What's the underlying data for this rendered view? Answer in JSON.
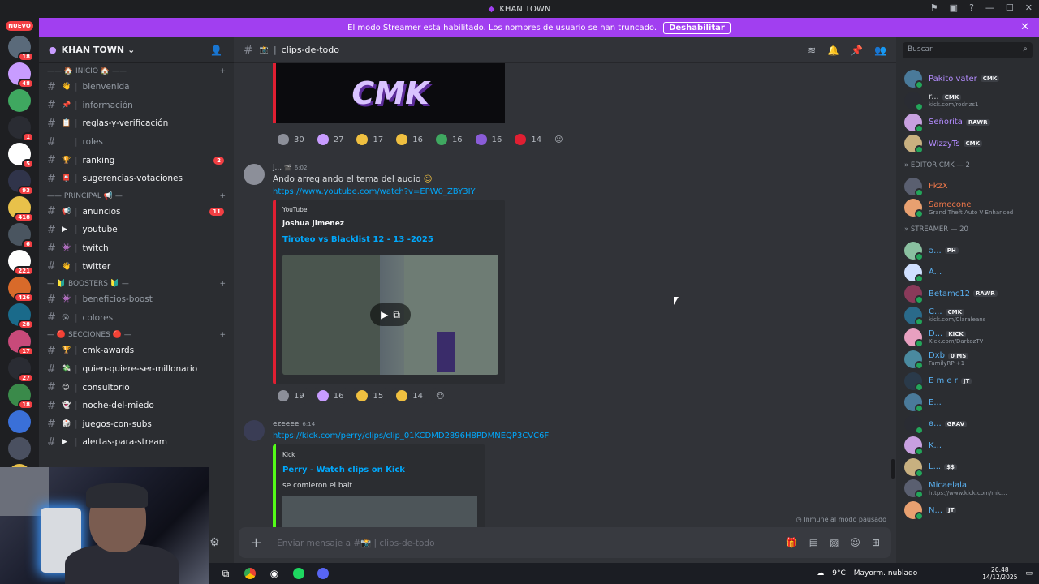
{
  "window": {
    "title": "KHAN TOWN"
  },
  "banner": {
    "message": "El modo Streamer está habilitado. Los nombres de usuario se han truncado.",
    "button": "Deshabilitar"
  },
  "servers": {
    "nuevo": "NUEVO",
    "badges": [
      "18",
      "48",
      "",
      "1",
      "5",
      "93",
      "418",
      "6",
      "221",
      "426",
      "28",
      "17",
      "27",
      "18",
      "",
      "",
      ""
    ]
  },
  "server_name": "KHAN TOWN",
  "categories": {
    "inicio": "INICIO",
    "principal": "PRINCIPAL",
    "boosters": "BOOSTERS",
    "secciones": "SECCIONES"
  },
  "channels_inicio": [
    {
      "name": "bienvenida",
      "emoji": "👋",
      "bold": false,
      "count": ""
    },
    {
      "name": "información",
      "emoji": "📌",
      "bold": false,
      "count": ""
    },
    {
      "name": "reglas-y-verificación",
      "emoji": "📋",
      "bold": true,
      "count": ""
    },
    {
      "name": "roles",
      "emoji": "",
      "bold": false,
      "count": ""
    },
    {
      "name": "ranking",
      "emoji": "🏆",
      "bold": true,
      "count": "2"
    },
    {
      "name": "sugerencias-votaciones",
      "emoji": "📮",
      "bold": true,
      "count": ""
    }
  ],
  "channels_principal": [
    {
      "name": "anuncios",
      "emoji": "📢",
      "bold": true,
      "count": "11"
    },
    {
      "name": "youtube",
      "emoji": "▶",
      "bold": true,
      "count": ""
    },
    {
      "name": "twitch",
      "emoji": "👾",
      "bold": true,
      "count": ""
    },
    {
      "name": "twitter",
      "emoji": "👋",
      "bold": true,
      "count": ""
    }
  ],
  "channels_boosters": [
    {
      "name": "beneficios-boost",
      "emoji": "👾",
      "bold": false,
      "count": ""
    },
    {
      "name": "colores",
      "emoji": "😵",
      "bold": false,
      "count": ""
    }
  ],
  "channels_secciones": [
    {
      "name": "cmk-awards",
      "emoji": "🏆",
      "bold": true,
      "count": ""
    },
    {
      "name": "quien-quiere-ser-millonario",
      "emoji": "💸",
      "bold": true,
      "count": ""
    },
    {
      "name": "consultorio",
      "emoji": "😊",
      "bold": true,
      "count": ""
    },
    {
      "name": "noche-del-miedo",
      "emoji": "👻",
      "bold": true,
      "count": ""
    },
    {
      "name": "juegos-con-subs",
      "emoji": "🎲",
      "bold": true,
      "count": ""
    },
    {
      "name": "alertas-para-stream",
      "emoji": "▶",
      "bold": true,
      "count": ""
    }
  ],
  "header": {
    "channel": "clips-de-todo"
  },
  "messages": {
    "reactions1": [
      "30",
      "27",
      "17",
      "16",
      "16",
      "16",
      "14"
    ],
    "msg2": {
      "author": "j...",
      "time": "6:02",
      "text": "Ando arreglando el tema del audio",
      "link": "https://www.youtube.com/watch?v=EPW0_ZBY3IY",
      "provider": "YouTube",
      "embed_author": "joshua jimenez",
      "embed_title": "Tiroteo vs Blacklist 12 - 13 -2025"
    },
    "reactions2": [
      "19",
      "16",
      "15",
      "14"
    ],
    "msg3": {
      "author": "ezeeee",
      "time": "6:14",
      "link": "https://kick.com/perry/clips/clip_01KCDMD2896H8PDMNEQP3CVC6F",
      "provider": "Kick",
      "embed_title": "Perry - Watch clips on Kick",
      "embed_desc": "se comieron el bait"
    }
  },
  "immune": "Inmune al modo pausado",
  "composer": {
    "placeholder": "Enviar mensaje a #📸 | clips-de-todo"
  },
  "search": {
    "placeholder": "Buscar"
  },
  "members_top": [
    {
      "name": "Pakito vater",
      "tag": "CMK",
      "sub": "",
      "color": "#b48cff"
    },
    {
      "name": "r...",
      "tag": "CMK",
      "sub": "kick.com/rodrizs1",
      "color": "#dbdee1"
    },
    {
      "name": "Señorita",
      "tag": "RAWR",
      "sub": "",
      "color": "#b48cff"
    },
    {
      "name": "WizzyTs",
      "tag": "CMK",
      "sub": "",
      "color": "#b48cff"
    }
  ],
  "cat_editor": "EDITOR CMK — 2",
  "members_editor": [
    {
      "name": "FkzX",
      "tag": "",
      "sub": "",
      "color": "#f0784a"
    },
    {
      "name": "Samecone",
      "tag": "",
      "sub": "Grand Theft Auto V Enhanced",
      "color": "#f0784a"
    }
  ],
  "cat_streamer": "STREAMER — 20",
  "members_streamer": [
    {
      "name": "ə...",
      "tag": "PH",
      "sub": "",
      "color": "#5ab0f0"
    },
    {
      "name": "A...",
      "tag": "",
      "sub": "",
      "color": "#5ab0f0"
    },
    {
      "name": "Betamc12",
      "tag": "RAWR",
      "sub": "",
      "color": "#5ab0f0"
    },
    {
      "name": "C...",
      "tag": "CMK",
      "sub": "kick.com/Claraleans",
      "color": "#5ab0f0"
    },
    {
      "name": "D...",
      "tag": "KICK",
      "sub": "Kick.com/DarkozTV",
      "color": "#5ab0f0"
    },
    {
      "name": "Dxb",
      "tag": "0 MS",
      "sub": "FamilyRP +1",
      "color": "#5ab0f0"
    },
    {
      "name": "E m e r",
      "tag": "JT",
      "sub": "",
      "color": "#5ab0f0"
    },
    {
      "name": "E...",
      "tag": "",
      "sub": "",
      "color": "#5ab0f0"
    },
    {
      "name": "ɵ...",
      "tag": "GRAV",
      "sub": "",
      "color": "#5ab0f0"
    },
    {
      "name": "K...",
      "tag": "",
      "sub": "",
      "color": "#5ab0f0"
    },
    {
      "name": "L...",
      "tag": "$$",
      "sub": "",
      "color": "#5ab0f0"
    },
    {
      "name": "Micaelala",
      "tag": "",
      "sub": "https://www.kick.com/mic...",
      "color": "#5ab0f0"
    },
    {
      "name": "N...",
      "tag": "JT",
      "sub": "",
      "color": "#5ab0f0"
    }
  ],
  "taskbar": {
    "weather_temp": "9°C",
    "weather": "Mayorm. nublado",
    "time": "20:48",
    "date": "14/12/2025"
  }
}
